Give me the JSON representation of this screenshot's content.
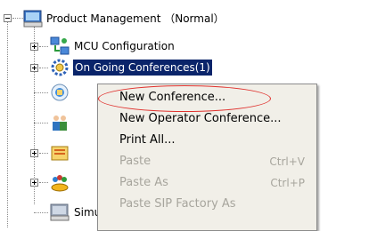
{
  "tree": {
    "root_label": "Product Management  （Normal）",
    "items": [
      {
        "label": "MCU Configuration",
        "icon": "mcu-config-icon"
      },
      {
        "label": "On Going Conferences(1)",
        "icon": "conferences-gear-icon",
        "selected": true
      },
      {
        "label": "",
        "icon": "globe-icon"
      },
      {
        "label": "",
        "icon": "users-group-icon"
      },
      {
        "label": "",
        "icon": "folder-list-icon"
      },
      {
        "label": "",
        "icon": "people-database-icon"
      },
      {
        "label": "Simu",
        "icon": "server-icon"
      }
    ]
  },
  "context_menu": {
    "items": [
      {
        "label": "New Conference...",
        "shortcut": "",
        "enabled": true
      },
      {
        "label": "New Operator Conference...",
        "shortcut": "",
        "enabled": true
      },
      {
        "label": "Print All...",
        "shortcut": "",
        "enabled": true
      },
      {
        "label": "Paste",
        "shortcut": "Ctrl+V",
        "enabled": false
      },
      {
        "label": "Paste As",
        "shortcut": "Ctrl+P",
        "enabled": false
      },
      {
        "label": "Paste SIP Factory As",
        "shortcut": "",
        "enabled": false
      }
    ]
  },
  "colors": {
    "selection": "#0a246a",
    "menu_bg": "#f1efe8",
    "annotation": "#e0322e"
  }
}
